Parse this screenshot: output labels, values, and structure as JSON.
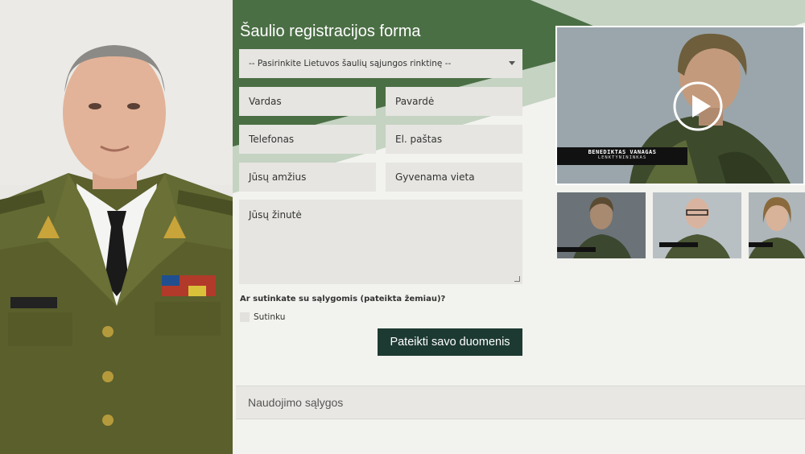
{
  "form": {
    "title": "Šaulio registracijos forma",
    "select_placeholder": "-- Pasirinkite Lietuvos šaulių sąjungos rinktinę --",
    "fields": {
      "first_name": "Vardas",
      "last_name": "Pavardė",
      "phone": "Telefonas",
      "email": "El. paštas",
      "age": "Jūsų amžius",
      "residence": "Gyvenama vieta",
      "message": "Jūsų žinutė"
    },
    "consent_question": "Ar sutinkate su sąlygomis (pateikta žemiau)?",
    "consent_label": "Sutinku",
    "submit_label": "Pateikti savo duomenis"
  },
  "terms": {
    "label": "Naudojimo sąlygos"
  },
  "video": {
    "caption_name": "BENEDIKTAS VANAGAS",
    "caption_role": "LENKTYNININKAS",
    "play_icon": "play-icon",
    "thumbnails": 3
  },
  "colors": {
    "dark_green": "#4b6f45",
    "light_band": "#c5d3c2",
    "button": "#1d3a32",
    "field": "#e6e5e1",
    "page_bg": "#f2f2ee"
  }
}
